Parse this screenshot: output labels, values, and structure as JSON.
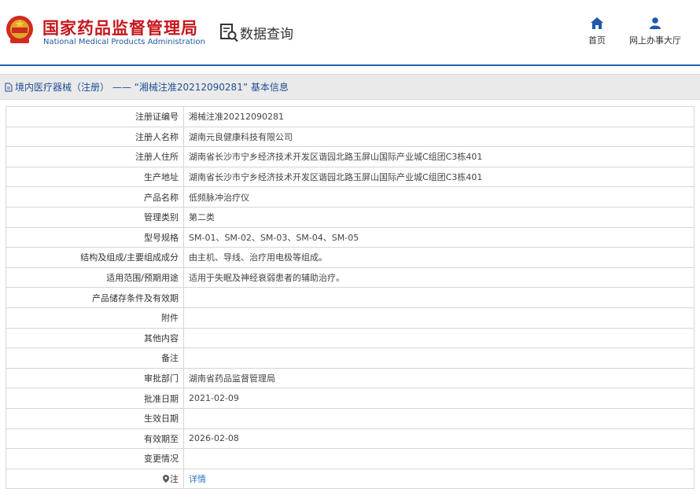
{
  "header": {
    "site_name_cn": "国家药品监督管理局",
    "site_name_en": "National Medical Products Administration",
    "data_query_label": "数据查询",
    "nav_home": "首页",
    "nav_online_service": "网上办事大厅"
  },
  "title_bar": {
    "text": "境内医疗器械（注册） —— “湘械注准20212090281” 基本信息"
  },
  "records": [
    {
      "label": "注册证编号",
      "value": "湘械注准20212090281"
    },
    {
      "label": "注册人名称",
      "value": "湖南元良健康科技有限公司"
    },
    {
      "label": "注册人住所",
      "value": "湖南省长沙市宁乡经济技术开发区谐园北路玉屏山国际产业城C组团C3栋401"
    },
    {
      "label": "生产地址",
      "value": "湖南省长沙市宁乡经济技术开发区谐园北路玉屏山国际产业城C组团C3栋401"
    },
    {
      "label": "产品名称",
      "value": "低频脉冲治疗仪"
    },
    {
      "label": "管理类别",
      "value": "第二类"
    },
    {
      "label": "型号规格",
      "value": "SM-01、SM-02、SM-03、SM-04、SM-05"
    },
    {
      "label": "结构及组成/主要组成成分",
      "value": "由主机、导线、治疗用电极等组成。"
    },
    {
      "label": "适用范围/预期用途",
      "value": "适用于失眠及神经衰弱患者的辅助治疗。"
    },
    {
      "label": "产品储存条件及有效期",
      "value": ""
    },
    {
      "label": "附件",
      "value": ""
    },
    {
      "label": "其他内容",
      "value": ""
    },
    {
      "label": "备注",
      "value": ""
    },
    {
      "label": "审批部门",
      "value": "湖南省药品监督管理局"
    },
    {
      "label": "批准日期",
      "value": "2021-02-09"
    },
    {
      "label": "生效日期",
      "value": ""
    },
    {
      "label": "有效期至",
      "value": "2026-02-08"
    },
    {
      "label": "变更情况",
      "value": ""
    }
  ],
  "note": {
    "label": "注",
    "link_text": "详情",
    "icon": "location-pin-icon"
  },
  "colors": {
    "brand_red": "#c5171d",
    "brand_blue": "#1f64b4",
    "link_blue": "#2f73c8"
  }
}
